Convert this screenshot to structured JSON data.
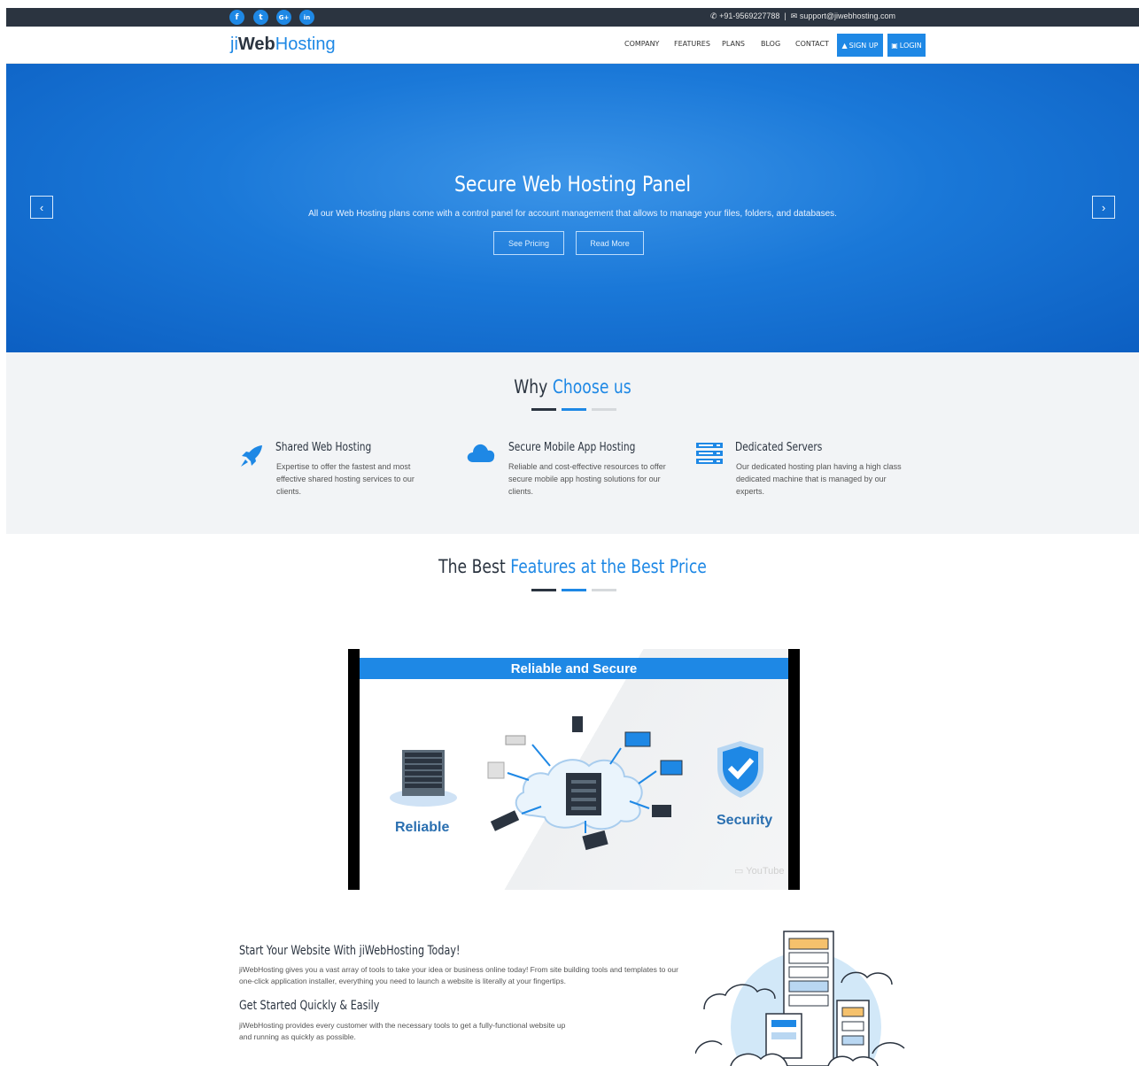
{
  "topbar": {
    "social": [
      {
        "name": "facebook-icon",
        "glyph": "f"
      },
      {
        "name": "twitter-icon",
        "glyph": "t"
      },
      {
        "name": "google-plus-icon",
        "glyph": "G+"
      },
      {
        "name": "linkedin-icon",
        "glyph": "in"
      }
    ],
    "phone": "+91-9569227788",
    "separator": "|",
    "email": "support@jiwebhosting.com"
  },
  "brand": {
    "ji": "ji",
    "web": "Web",
    "hosting": "Hosting"
  },
  "nav": {
    "items": [
      "COMPANY",
      "FEATURES",
      "PLANS",
      "BLOG",
      "CONTACT"
    ],
    "signup": "SIGN UP",
    "login": "LOGIN"
  },
  "hero": {
    "title": "Secure Web Hosting Panel",
    "subtitle": "All our Web Hosting plans come with a control panel for account management that allows to manage your files, folders, and databases.",
    "btn_pricing": "See Pricing",
    "btn_more": "Read More",
    "prev": "‹",
    "next": "›"
  },
  "why": {
    "title_plain": "Why ",
    "title_accent": "Choose us",
    "features": [
      {
        "title": "Shared Web Hosting",
        "desc": "Expertise to offer the fastest and most effective shared hosting services to our clients."
      },
      {
        "title": "Secure Mobile App Hosting",
        "desc": "Reliable and cost-effective resources to offer secure mobile app hosting solutions for our clients."
      },
      {
        "title": "Dedicated Servers",
        "desc": "Our dedicated hosting plan having a high class dedicated machine that is managed by our experts."
      }
    ]
  },
  "best": {
    "title_plain": "The Best ",
    "title_accent": "Features at the Best Price"
  },
  "video": {
    "header": "Reliable and Secure",
    "label_left": "Reliable",
    "label_right": "Security",
    "youtube": "YouTube"
  },
  "bottom": {
    "h1": "Start Your Website With jiWebHosting Today!",
    "p1": "jiWebHosting gives you a vast array of tools to take your idea or business online today! From site building tools and templates to our one-click application installer, everything you need to launch a website is literally at your fingertips.",
    "h2": "Get Started Quickly & Easily",
    "p2": "jiWebHosting provides every customer with the necessary tools to get a fully-functional website up and running as quickly as possible."
  },
  "colors": {
    "accent": "#1e88e5",
    "dark": "#2b3440",
    "underline_dark": "#2b3440",
    "underline_light": "#d6d9dc"
  }
}
